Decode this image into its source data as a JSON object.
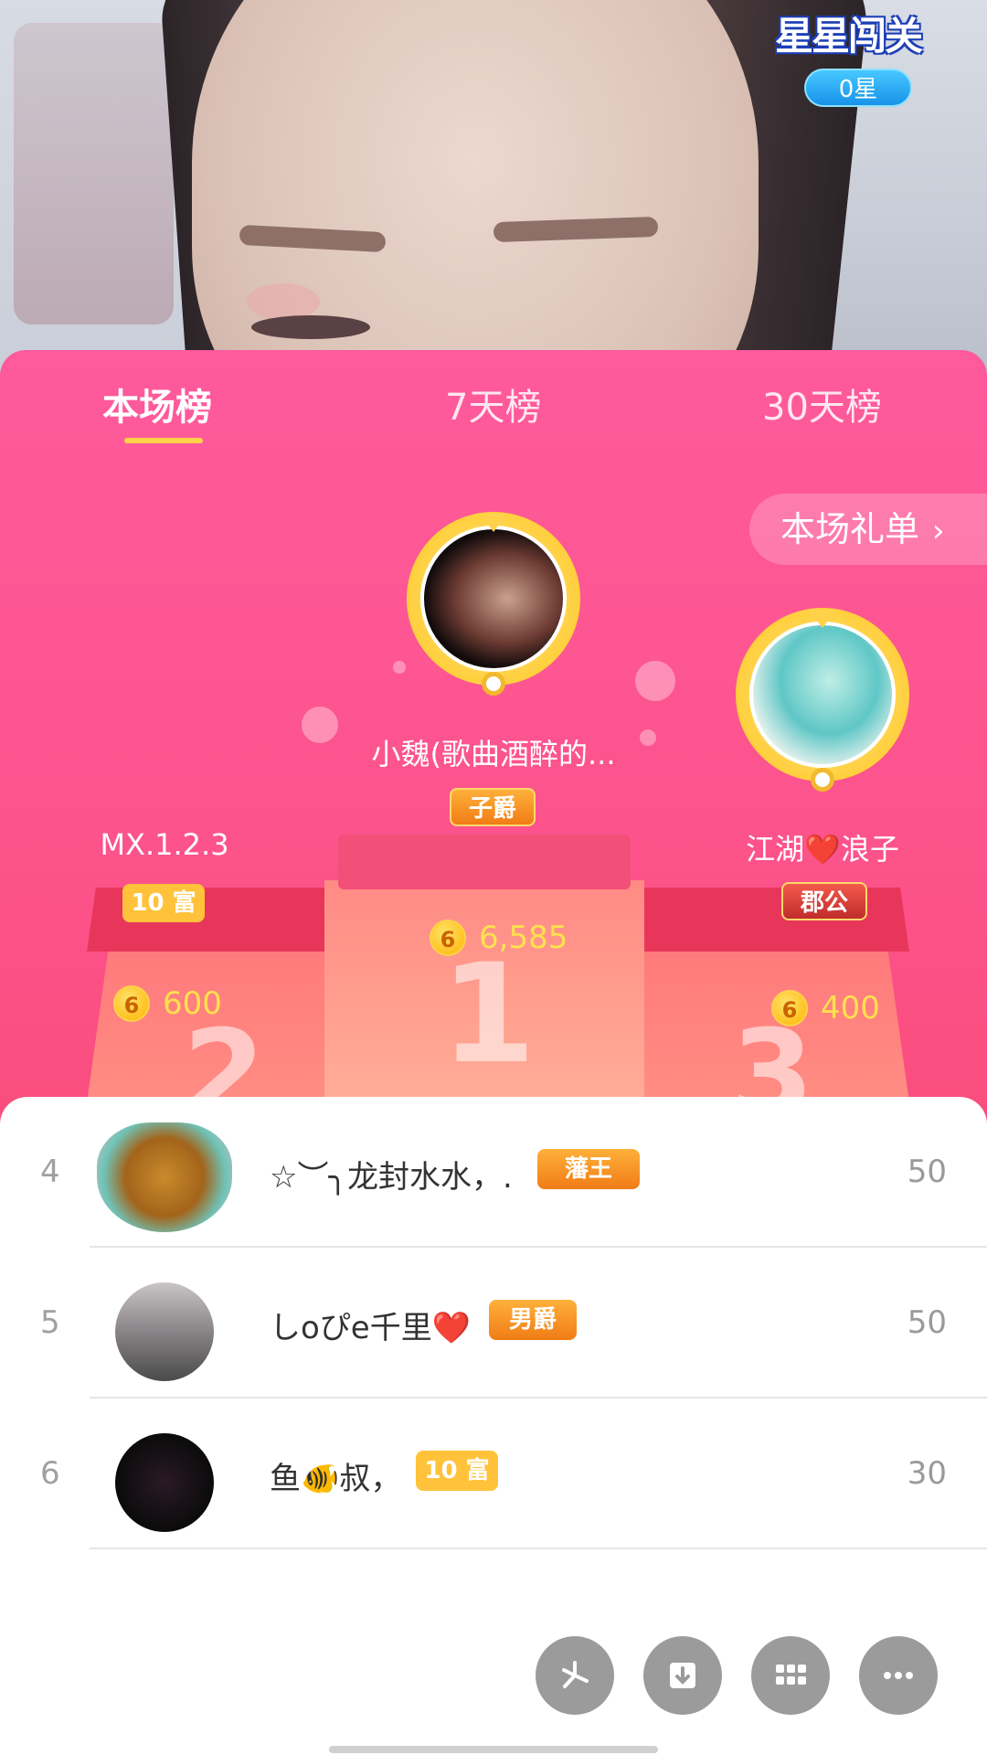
{
  "live_stream": {
    "star_challenge_logo": "星星闯关",
    "star_count": "0星"
  },
  "tabs": [
    {
      "label": "本场榜",
      "active": true
    },
    {
      "label": "7天榜",
      "active": false
    },
    {
      "label": "30天榜",
      "active": false
    }
  ],
  "gift_list_button": {
    "label": "本场礼单",
    "icon": "chevron-right-icon"
  },
  "podium": {
    "first": {
      "rank": "1",
      "name": "小魏(歌曲酒醉的...",
      "badge": "子爵",
      "coins": "6,585"
    },
    "second": {
      "rank": "2",
      "name": "MX.1.2.3",
      "badge": "10 富",
      "coins": "600"
    },
    "third": {
      "rank": "3",
      "name": "江湖❤️浪子",
      "badge": "郡公",
      "coins": "400"
    }
  },
  "coin_icon_glyph": "6",
  "ranking_list": [
    {
      "rank": "4",
      "name": "☆︶╮龙封水水，.",
      "badge": "藩王",
      "score": "50"
    },
    {
      "rank": "5",
      "name": "しoぴe千里❤️",
      "badge": "男爵",
      "score": "50"
    },
    {
      "rank": "6",
      "name": "鱼🐠叔，",
      "badge": "10 富",
      "score": "30"
    }
  ],
  "fab_icons": [
    "pinwheel-icon",
    "download-icon",
    "grid-icon",
    "more-icon"
  ],
  "colors": {
    "panel_pink": "#fc5289",
    "tab_underline": "#ffd24a",
    "coin_value": "#ffe14d",
    "rank_text": "#a0a0a0"
  }
}
